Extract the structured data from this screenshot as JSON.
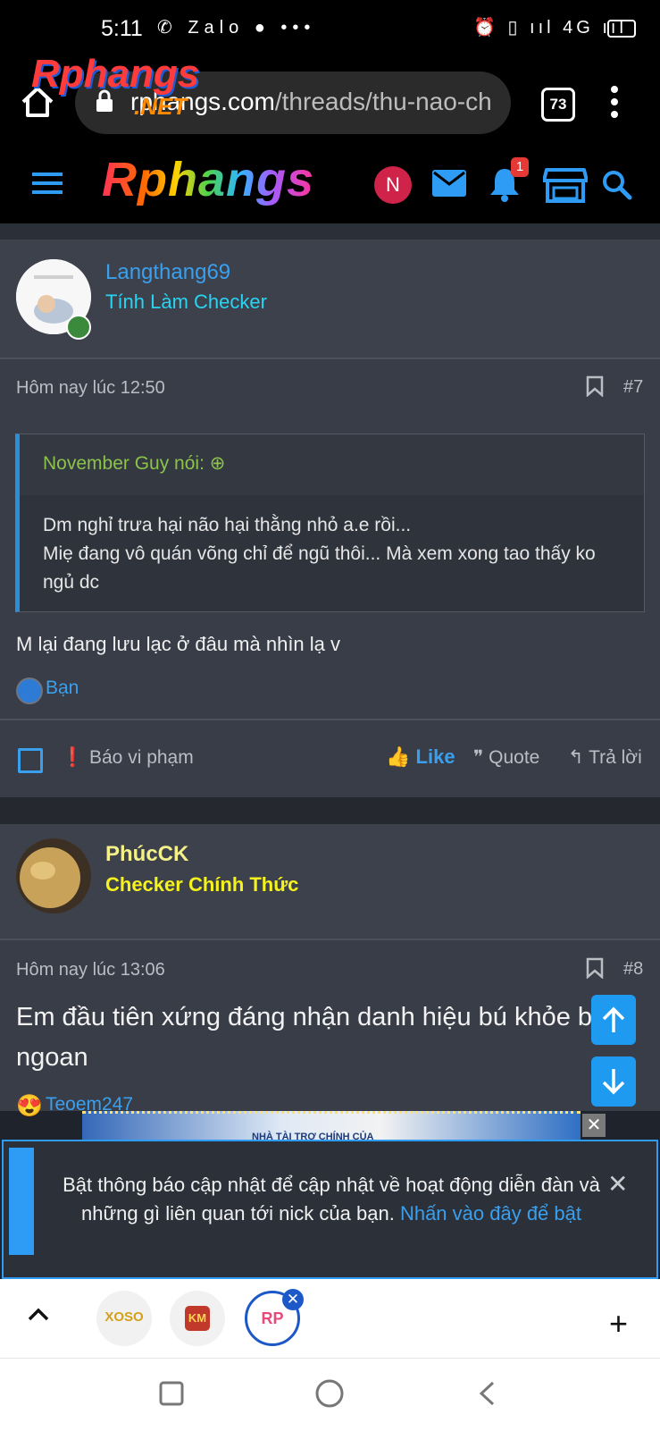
{
  "status_bar": {
    "time": "5:11",
    "left_icons": "✆ Zalo ● •••",
    "right_icons": "⏰ ▯ ııl 4G ııl"
  },
  "browser": {
    "url_domain": "rphangs.com",
    "url_path": "/threads/thu-nao-ch",
    "tab_count": "73",
    "overlay_logo": "Rphangs",
    "overlay_net": ".NET"
  },
  "site_header": {
    "logo": "Rphangs",
    "avatar_letter": "N",
    "notification_count": "1"
  },
  "posts": [
    {
      "username": "Langthang69",
      "user_title": "Tính Làm Checker",
      "time": "Hôm nay lúc 12:50",
      "number": "#7",
      "quote_author": "November Guy nói:",
      "quote_lines": [
        "Dm nghỉ trưa hại não hại thằng nhỏ a.e rồi...",
        "Miẹ đang vô quán võng chỉ để ngũ thôi... Mà xem xong tao thấy ko ngủ dc"
      ],
      "text": "M lại đang lưu lạc ở đâu mà nhìn lạ v",
      "reaction_user": "Bạn",
      "actions": {
        "report": "Báo vi phạm",
        "like": "Like",
        "quote": "Quote",
        "reply": "Trả lời"
      }
    },
    {
      "username": "PhúcCK",
      "user_title": "Checker Chính Thức",
      "time": "Hôm nay lúc 13:06",
      "number": "#8",
      "text": "Em đầu tiên xứng đáng nhận danh hiệu bú khỏe bú ngoan",
      "reaction_user": "Teoem247"
    }
  ],
  "ad": {
    "text": "NHÀ TÀI TRỢ CHÍNH CỦA"
  },
  "notification": {
    "text": "Bật thông báo cập nhật để cập nhật về hoạt động diễn đàn và những gì liên quan tới nick của bạn.",
    "link": "Nhấn vào đây để bật"
  },
  "tab_chips": [
    "XOSO",
    "KM",
    "RP"
  ],
  "colors": {
    "accent": "#2e9cf5",
    "post_bg": "#393d47",
    "username_blue": "#3aa0ee",
    "title_cyan": "#29d4f2",
    "username_yellow": "#f4f08a",
    "title_yellow": "#f5f21d",
    "quote_green": "#8bc34a"
  }
}
